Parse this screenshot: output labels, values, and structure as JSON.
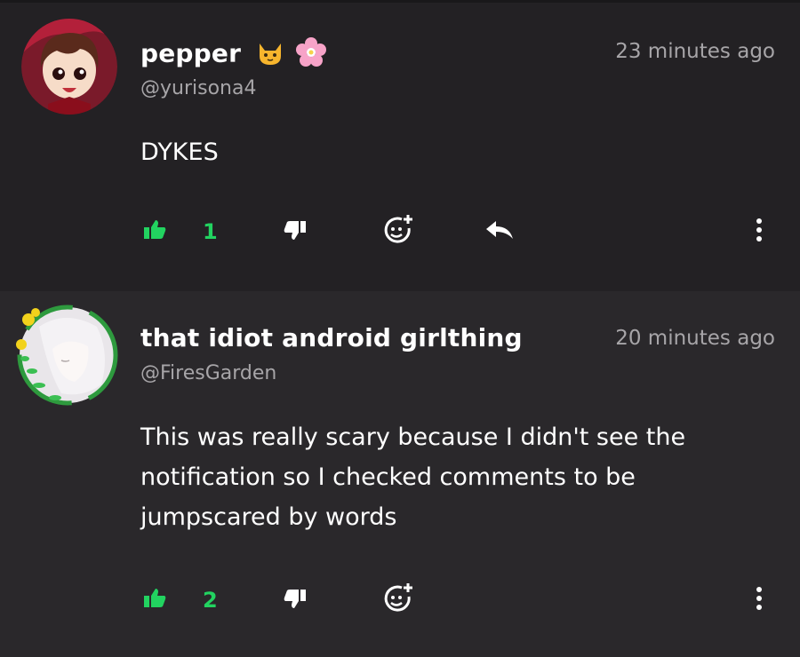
{
  "comments": [
    {
      "name": "pepper",
      "handle": "@yurisona4",
      "time": "23 minutes ago",
      "body": "DYKES",
      "likes": "1",
      "name_emojis": [
        "cat-face-emoji",
        "cherry-blossom-emoji"
      ]
    },
    {
      "name": "that idiot android girlthing",
      "handle": "@FiresGarden",
      "time": "20 minutes ago",
      "body": "This was really scary because I didn't see the notification so I checked comments to be jumpscared by words",
      "likes": "2"
    }
  ],
  "colors": {
    "accent": "#22d360",
    "muted": "#a7a5a8",
    "bg_top": "#232124",
    "bg_bottom": "#2a282b"
  },
  "icons": [
    "thumbs-up-icon",
    "thumbs-down-icon",
    "add-reaction-icon",
    "reply-icon",
    "more-vertical-icon"
  ]
}
